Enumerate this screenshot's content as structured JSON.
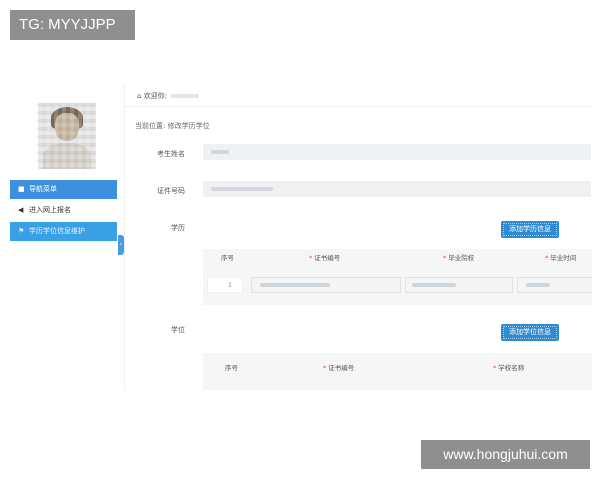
{
  "watermark": {
    "top": "TG: MYYJJPP",
    "bottom": "www.hongjuhui.com"
  },
  "sidebar": {
    "items": [
      {
        "label": "导航菜单",
        "icon": "menu-icon"
      },
      {
        "label": "进入网上报名",
        "icon": "arrow-icon"
      },
      {
        "label": "学历学位信息维护",
        "icon": "flag-icon"
      }
    ]
  },
  "topbar": {
    "welcome": "欢迎你:"
  },
  "breadcrumb": "当前位置:  修改学历学位",
  "form": {
    "name_label": "考生姓名",
    "id_label": "证件号码",
    "edu_label": "学历",
    "degree_label": "学位",
    "add_edu_button": "添加学历信息",
    "add_degree_button": "添加学位信息"
  },
  "edu_table": {
    "headers": [
      "序号",
      "证书编号",
      "毕业院校",
      "毕业时间"
    ],
    "required": [
      false,
      true,
      true,
      true
    ],
    "rows": [
      {
        "index": "1"
      }
    ]
  },
  "degree_table": {
    "headers": [
      "序号",
      "证书编号",
      "学校名称"
    ],
    "required": [
      false,
      true,
      true
    ]
  },
  "colors": {
    "primary": "#3d8fe0",
    "button": "#2f8bd1",
    "required": "#e2463e"
  }
}
